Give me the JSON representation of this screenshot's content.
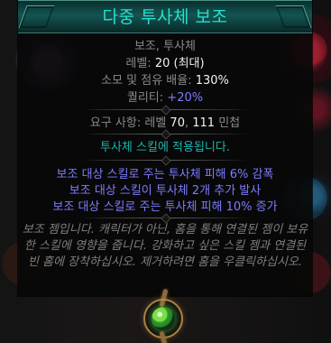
{
  "tooltip": {
    "title": "다중 투사체 보조",
    "tags": "보조, 투사체",
    "level_label": "레벨:",
    "level_value": "20 (최대)",
    "cost_label": "소모 및 점유 배율:",
    "cost_value": "130%",
    "quality_label": "퀄리티:",
    "quality_value": "+20%",
    "req_prefix": "요구 사항:",
    "req_level_label": "레벨",
    "req_level_value": "70",
    "req_dex_value": "111",
    "req_dex_label": "민첩",
    "applies_text": "투사체 스킬에 적용됩니다.",
    "mods": [
      "보조 대상 스킬로 주는 투사체 피해 6% 감폭",
      "보조 대상 스킬이 투사체 2개 추가 발사",
      "보조 대상 스킬로 주는 투사체 피해 10% 증가"
    ],
    "description": "보조 젬입니다. 캐릭터가 아닌, 홈을 통해 연결된 젬이 보유한 스킬에 영향을 줍니다. 강화하고 싶은 스킬 젬과 연결된 빈 홈에 장착하십시오. 제거하려면 홈을 우클릭하십시오."
  },
  "colors": {
    "title": "#24dfd0",
    "header_bg": "#125a55",
    "label": "#8a8a8a",
    "value": "#f2f2f2",
    "quality": "#7c7cff",
    "applies": "#1ab6ad",
    "mods": "#7c7cff",
    "description": "#7f7f7f"
  },
  "icons": {
    "gem": "green-skill-gem-icon",
    "background_left": "purple-glow-icon",
    "background_right": "inventory-items-icon"
  }
}
